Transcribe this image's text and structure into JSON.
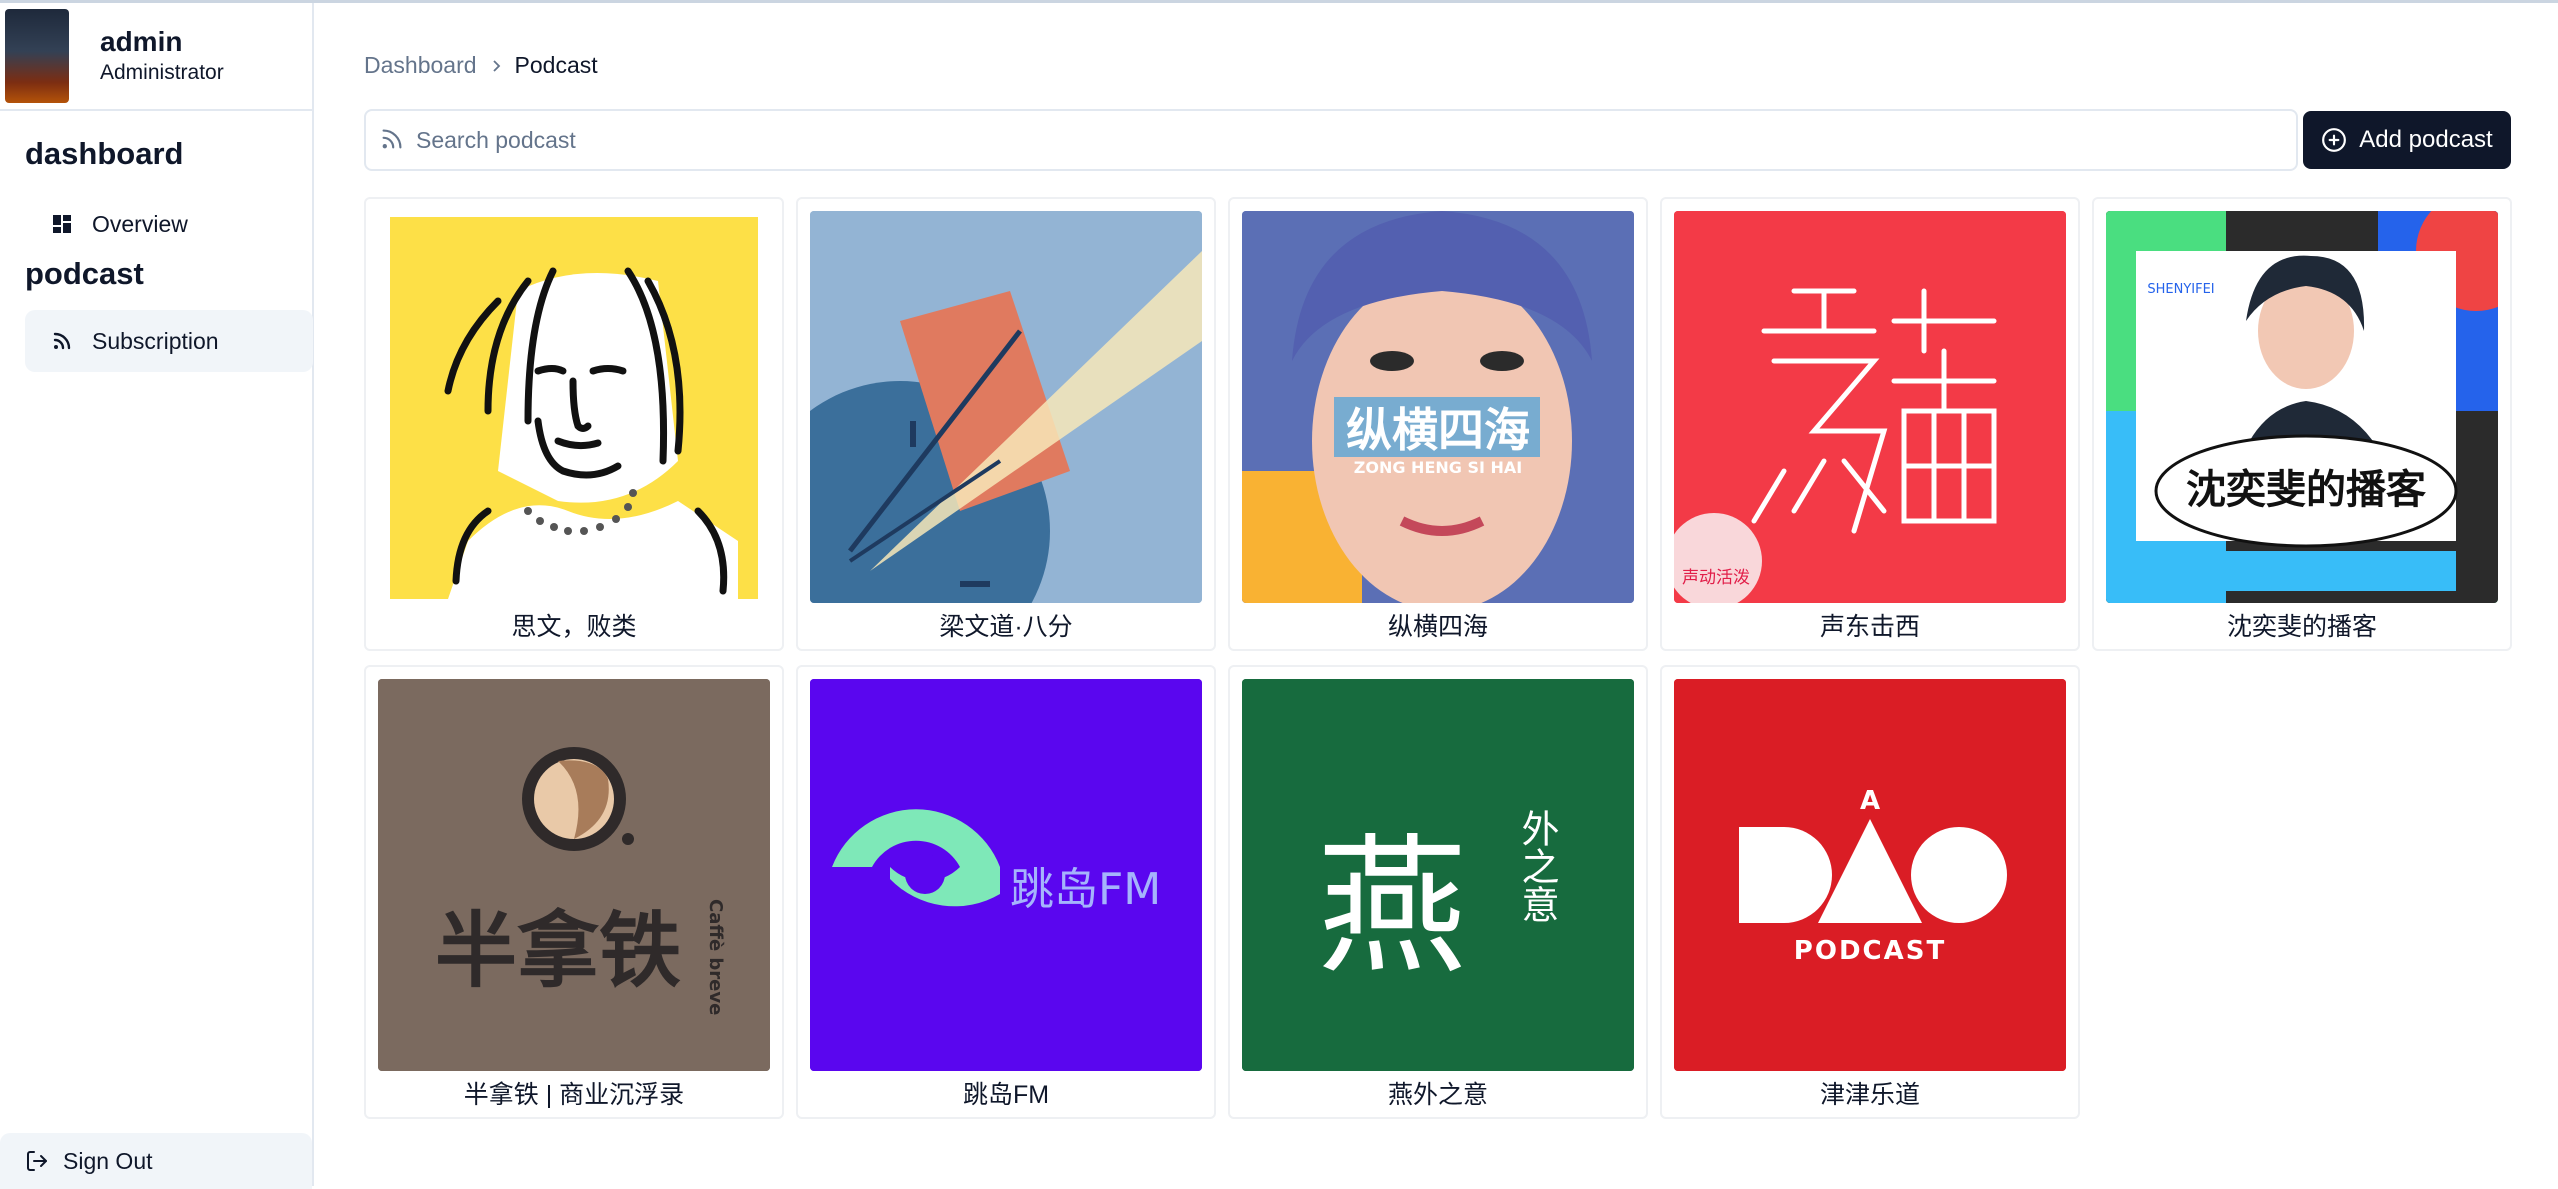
{
  "user": {
    "name": "admin",
    "role": "Administrator"
  },
  "sidebar": {
    "sections": [
      {
        "title": "dashboard",
        "items": [
          {
            "label": "Overview",
            "icon": "dashboard-grid-icon"
          }
        ]
      },
      {
        "title": "podcast",
        "items": [
          {
            "label": "Subscription",
            "icon": "rss-icon",
            "active": true
          }
        ]
      }
    ],
    "sign_out": "Sign Out"
  },
  "breadcrumb": {
    "parent": "Dashboard",
    "current": "Podcast"
  },
  "search": {
    "placeholder": "Search podcast",
    "value": ""
  },
  "add_button": {
    "label": "Add podcast"
  },
  "podcasts": [
    {
      "title": "思文，败类",
      "cover_text": ""
    },
    {
      "title": "梁文道·八分",
      "cover_text": ""
    },
    {
      "title": "纵横四海",
      "cover_text": "纵横四海",
      "cover_subtext": "ZONG HENG SI HAI"
    },
    {
      "title": "声东击西",
      "cover_text": "声东击西",
      "cover_badge": "声动活泼"
    },
    {
      "title": "沈奕斐的播客",
      "cover_text": "沈奕斐的播客",
      "cover_subtext": "SHENYIFEI"
    },
    {
      "title": "半拿铁 | 商业沉浮录",
      "cover_text": "半拿铁",
      "cover_subtext": "Caffè breve"
    },
    {
      "title": "跳岛FM",
      "cover_text": "跳岛FM"
    },
    {
      "title": "燕外之意",
      "cover_text": "燕",
      "cover_subtext": "外之意"
    },
    {
      "title": "津津乐道",
      "cover_text": "DAO",
      "cover_top": "A",
      "cover_subtext": "PODCAST"
    }
  ],
  "colors": {
    "primary_button": "#0f172a",
    "active_nav": "#f1f5f9",
    "muted_text": "#64748b",
    "border": "#e2e8f0"
  }
}
